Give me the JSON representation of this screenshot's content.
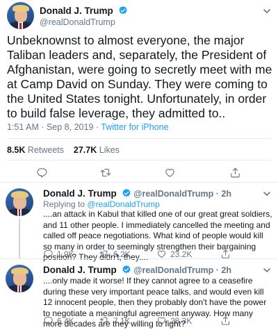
{
  "main_tweet": {
    "name": "Donald J. Trump",
    "handle": "@realDonaldTrump",
    "text": "Unbeknownst to almost everyone, the major Taliban leaders and, separately, the President of Afghanistan, were going to secretly meet with me at Camp David on Sunday. They were coming to the United States tonight. Unfortunately, in order to build false leverage, they admitted to..",
    "timestamp": "1:51 AM · Sep 8, 2019 ·",
    "source": "Twitter for iPhone",
    "retweets_count": "8.5K",
    "retweets_label": "Retweets",
    "likes_count": "27.7K",
    "likes_label": "Likes"
  },
  "replies": [
    {
      "name": "Donald J. Trump",
      "meta": "@realDonaldTrump · 2h",
      "replying_prefix": "Replying to",
      "replying_to": "@realDonaldTrump",
      "text": "....an attack in Kabul that killed one of our great great soldiers, and 11 other people. I immediately cancelled the meeting and called off peace negotiations. What kind of people would kill so many in order to seemingly strengthen their bargaining position? They didn't, they....",
      "replies": "1.9K",
      "retweets": "6.2K",
      "likes": "23.2K"
    },
    {
      "name": "Donald J. Trump",
      "meta": "@realDonaldTrump · 2h",
      "text": "....only made it worse! If they cannot agree to a ceasefire during these very important peace talks, and would even kill 12 innocent people, then they probably don't have the power to negotiate a meaningful agreement anyway. How many more decades are they willing to fight?",
      "replies": "6.4K",
      "retweets": "7.1K",
      "likes": "28.3K"
    }
  ],
  "icons": {
    "verified": "verified-badge-icon",
    "more": "chevron-down-icon",
    "reply": "reply-icon",
    "retweet": "retweet-icon",
    "like": "heart-icon",
    "share": "share-icon"
  },
  "colors": {
    "accent": "#1da1f2",
    "text": "#14171a",
    "muted": "#657786",
    "divider": "#e6ecf0"
  }
}
